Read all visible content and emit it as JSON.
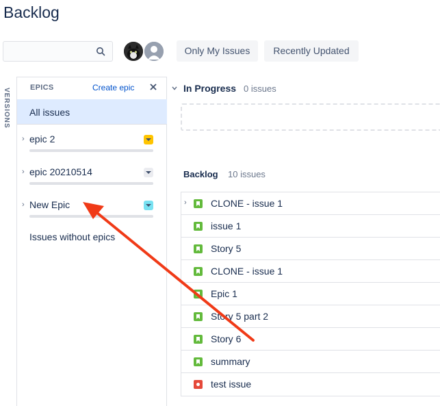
{
  "page": {
    "title": "Backlog"
  },
  "search": {
    "value": "",
    "placeholder": ""
  },
  "filters": {
    "only_my_issues": "Only My Issues",
    "recently_updated": "Recently Updated"
  },
  "versions": {
    "label": "VERSIONS"
  },
  "epics": {
    "header": "EPICS",
    "create_label": "Create epic",
    "all_issues": "All issues",
    "items": [
      {
        "name": "epic 2",
        "color": "#ffc400"
      },
      {
        "name": "epic 20210514",
        "color": "#ebecf0"
      },
      {
        "name": "New Epic",
        "color": "#79e2f2"
      }
    ],
    "without_epics": "Issues without epics"
  },
  "sprint": {
    "title": "In Progress",
    "count": "0 issues"
  },
  "backlog": {
    "title": "Backlog",
    "count": "10 issues",
    "issues": [
      {
        "summary": "CLONE - issue 1",
        "type": "story",
        "expandable": true
      },
      {
        "summary": "issue 1",
        "type": "story",
        "expandable": false
      },
      {
        "summary": "Story 5",
        "type": "story",
        "expandable": false
      },
      {
        "summary": "CLONE - issue 1",
        "type": "story",
        "expandable": false
      },
      {
        "summary": "Epic 1",
        "type": "story",
        "expandable": false
      },
      {
        "summary": "Story 5 part 2",
        "type": "story",
        "expandable": false
      },
      {
        "summary": "Story 6",
        "type": "story",
        "expandable": false
      },
      {
        "summary": "summary",
        "type": "story",
        "expandable": false
      },
      {
        "summary": "test issue",
        "type": "bug",
        "expandable": false
      }
    ]
  },
  "annotation": {
    "arrow_color": "#f03a17"
  }
}
